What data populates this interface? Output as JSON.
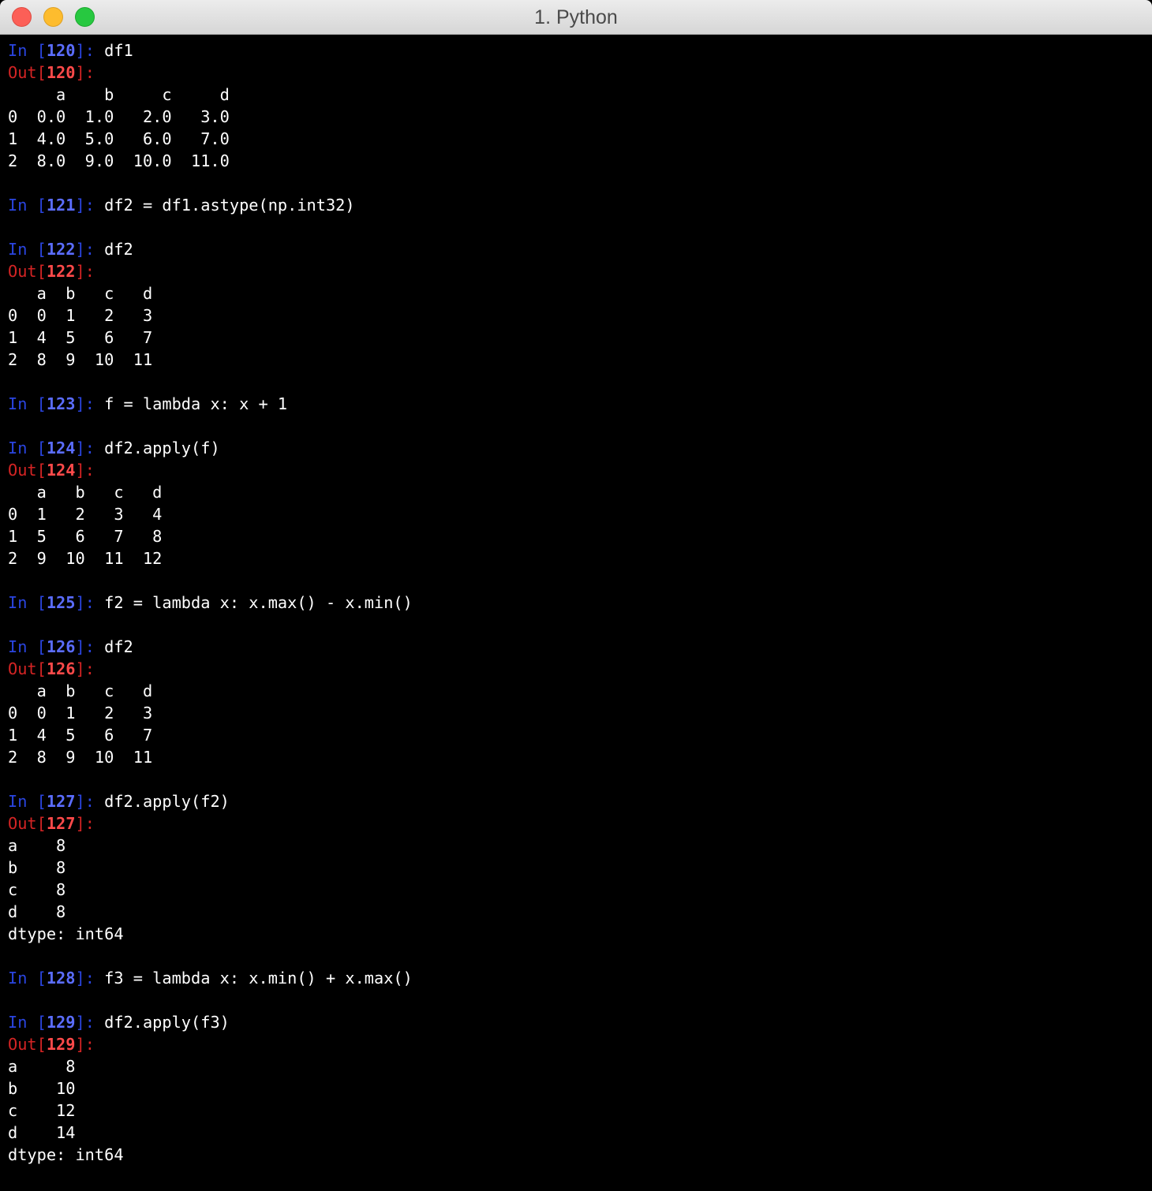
{
  "window": {
    "title": "1. Python"
  },
  "colors": {
    "background": "#000000",
    "text": "#ffffff",
    "in_prompt": "#2a45e0",
    "in_number": "#5b6dff",
    "out_prompt": "#d42424",
    "out_number": "#ff4a4a"
  },
  "lines": [
    {
      "type": "in",
      "num": "120",
      "code": "df1"
    },
    {
      "type": "out",
      "num": "120"
    },
    {
      "type": "text",
      "text": "     a    b     c     d"
    },
    {
      "type": "text",
      "text": "0  0.0  1.0   2.0   3.0"
    },
    {
      "type": "text",
      "text": "1  4.0  5.0   6.0   7.0"
    },
    {
      "type": "text",
      "text": "2  8.0  9.0  10.0  11.0"
    },
    {
      "type": "text",
      "text": ""
    },
    {
      "type": "in",
      "num": "121",
      "code": "df2 = df1.astype(np.int32)"
    },
    {
      "type": "text",
      "text": ""
    },
    {
      "type": "in",
      "num": "122",
      "code": "df2"
    },
    {
      "type": "out",
      "num": "122"
    },
    {
      "type": "text",
      "text": "   a  b   c   d"
    },
    {
      "type": "text",
      "text": "0  0  1   2   3"
    },
    {
      "type": "text",
      "text": "1  4  5   6   7"
    },
    {
      "type": "text",
      "text": "2  8  9  10  11"
    },
    {
      "type": "text",
      "text": ""
    },
    {
      "type": "in",
      "num": "123",
      "code": "f = lambda x: x + 1"
    },
    {
      "type": "text",
      "text": ""
    },
    {
      "type": "in",
      "num": "124",
      "code": "df2.apply(f)"
    },
    {
      "type": "out",
      "num": "124"
    },
    {
      "type": "text",
      "text": "   a   b   c   d"
    },
    {
      "type": "text",
      "text": "0  1   2   3   4"
    },
    {
      "type": "text",
      "text": "1  5   6   7   8"
    },
    {
      "type": "text",
      "text": "2  9  10  11  12"
    },
    {
      "type": "text",
      "text": ""
    },
    {
      "type": "in",
      "num": "125",
      "code": "f2 = lambda x: x.max() - x.min()"
    },
    {
      "type": "text",
      "text": ""
    },
    {
      "type": "in",
      "num": "126",
      "code": "df2"
    },
    {
      "type": "out",
      "num": "126"
    },
    {
      "type": "text",
      "text": "   a  b   c   d"
    },
    {
      "type": "text",
      "text": "0  0  1   2   3"
    },
    {
      "type": "text",
      "text": "1  4  5   6   7"
    },
    {
      "type": "text",
      "text": "2  8  9  10  11"
    },
    {
      "type": "text",
      "text": ""
    },
    {
      "type": "in",
      "num": "127",
      "code": "df2.apply(f2)"
    },
    {
      "type": "out",
      "num": "127"
    },
    {
      "type": "text",
      "text": "a    8"
    },
    {
      "type": "text",
      "text": "b    8"
    },
    {
      "type": "text",
      "text": "c    8"
    },
    {
      "type": "text",
      "text": "d    8"
    },
    {
      "type": "text",
      "text": "dtype: int64"
    },
    {
      "type": "text",
      "text": ""
    },
    {
      "type": "in",
      "num": "128",
      "code": "f3 = lambda x: x.min() + x.max()"
    },
    {
      "type": "text",
      "text": ""
    },
    {
      "type": "in",
      "num": "129",
      "code": "df2.apply(f3)"
    },
    {
      "type": "out",
      "num": "129"
    },
    {
      "type": "text",
      "text": "a     8"
    },
    {
      "type": "text",
      "text": "b    10"
    },
    {
      "type": "text",
      "text": "c    12"
    },
    {
      "type": "text",
      "text": "d    14"
    },
    {
      "type": "text",
      "text": "dtype: int64"
    }
  ]
}
